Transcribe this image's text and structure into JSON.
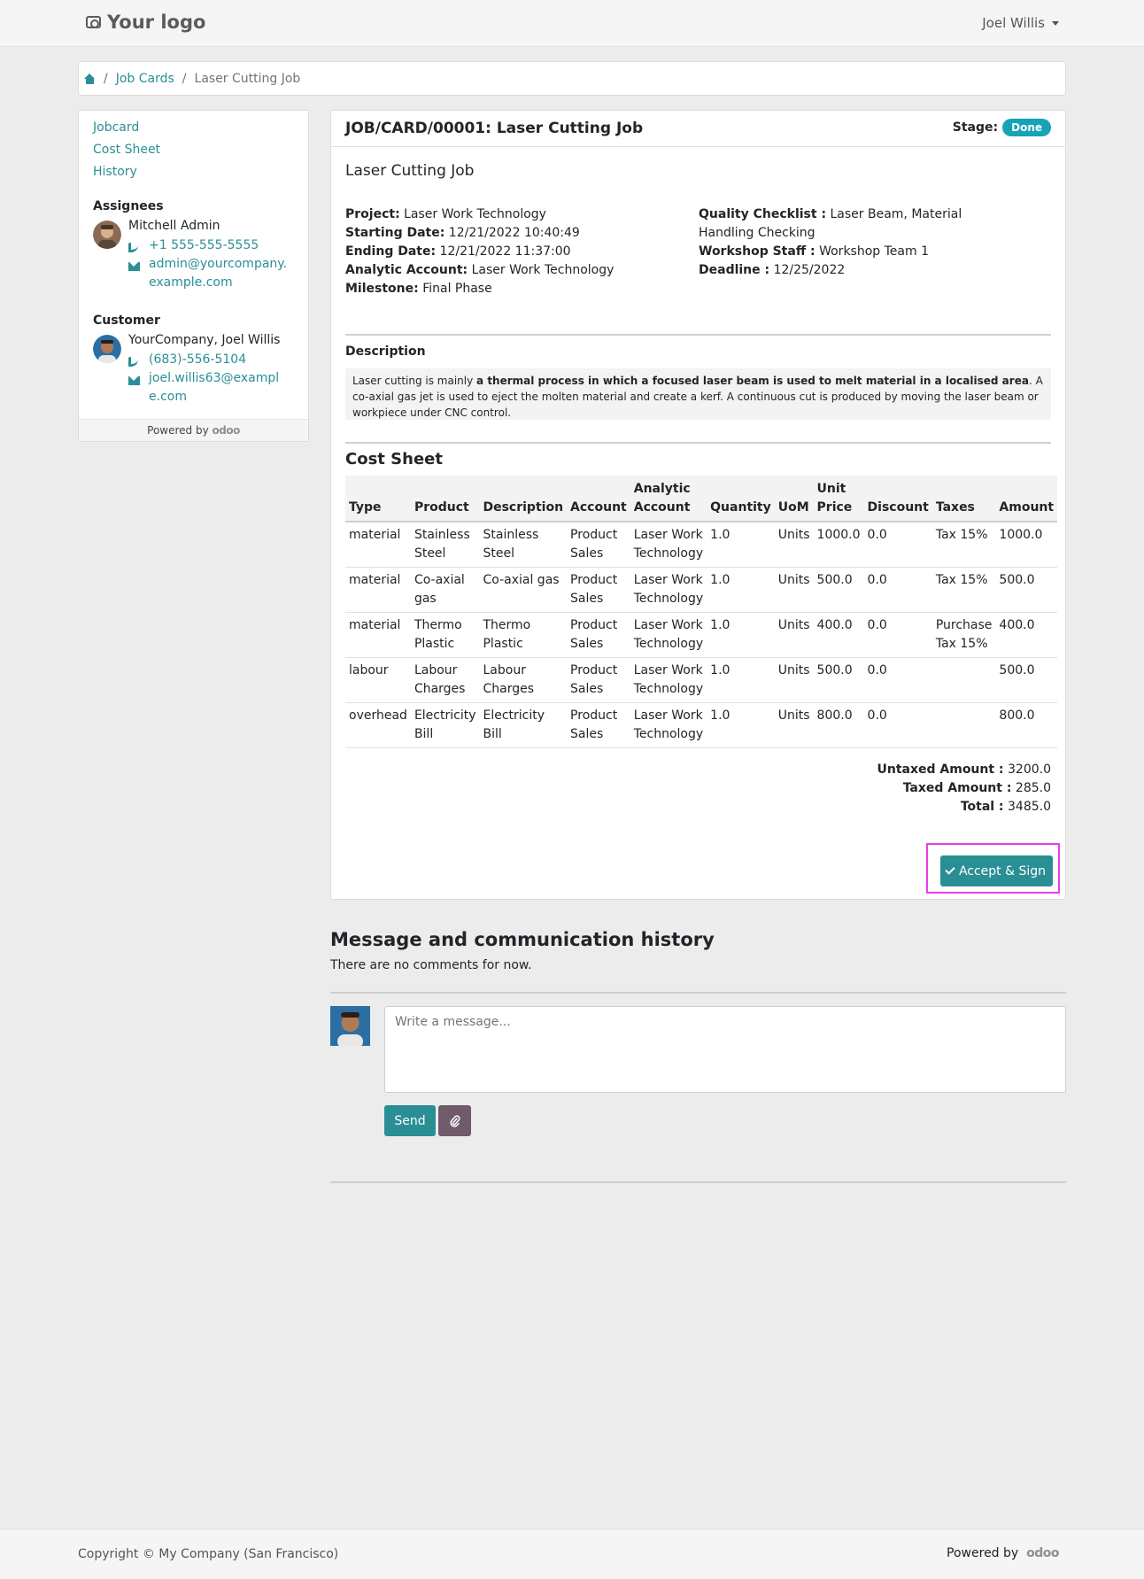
{
  "navbar": {
    "logo_text": "Your logo",
    "user_name": "Joel Willis"
  },
  "breadcrumb": {
    "home_icon": "home-icon",
    "job_cards": "Job Cards",
    "current": "Laser Cutting Job"
  },
  "sidebar": {
    "links": [
      "Jobcard",
      "Cost Sheet",
      "History"
    ],
    "assignees_heading": "Assignees",
    "assignee": {
      "name": "Mitchell Admin",
      "phone": "+1 555-555-5555",
      "email": "admin@yourcompany.example.com"
    },
    "customer_heading": "Customer",
    "customer": {
      "name": "YourCompany, Joel Willis",
      "phone": "(683)-556-5104",
      "email": "joel.willis63@example.com"
    },
    "powered_by": "Powered by",
    "brand": "odoo"
  },
  "card": {
    "title": "JOB/CARD/00001: Laser Cutting Job",
    "stage_label": "Stage:",
    "stage_value": "Done",
    "job_name": "Laser Cutting Job",
    "left_info": {
      "project_label": "Project:",
      "project": "Laser Work Technology",
      "start_label": "Starting Date:",
      "start": "12/21/2022 10:40:49",
      "end_label": "Ending Date:",
      "end": "12/21/2022 11:37:00",
      "analytic_label": "Analytic Account:",
      "analytic": "Laser Work Technology",
      "milestone_label": "Milestone:",
      "milestone": "Final Phase"
    },
    "right_info": {
      "checklist_label": "Quality Checklist :",
      "checklist": "Laser Beam, Material Handling Checking",
      "staff_label": "Workshop Staff :",
      "staff": "Workshop Team 1",
      "deadline_label": "Deadline :",
      "deadline": "12/25/2022"
    },
    "description_heading": "Description",
    "description": {
      "part1": "Laser cutting is mainly ",
      "bold": "a thermal process in which a focused laser beam is used to melt material in a localised area",
      "part2": ". A co-axial gas jet is used to eject the molten material and create a kerf. A continuous cut is produced by moving the laser beam or workpiece under CNC control."
    },
    "cost_sheet_title": "Cost Sheet",
    "table": {
      "headers": [
        "Type",
        "Product",
        "Description",
        "Account",
        "Analytic Account",
        "Quantity",
        "UoM",
        "Unit Price",
        "Discount",
        "Taxes",
        "Amount"
      ],
      "rows": [
        [
          "material",
          "Stainless Steel",
          "Stainless Steel",
          "Product Sales",
          "Laser Work Technology",
          "1.0",
          "Units",
          "1000.0",
          "0.0",
          "Tax 15%",
          "1000.0"
        ],
        [
          "material",
          "Co-axial gas",
          "Co-axial gas",
          "Product Sales",
          "Laser Work Technology",
          "1.0",
          "Units",
          "500.0",
          "0.0",
          "Tax 15%",
          "500.0"
        ],
        [
          "material",
          "Thermo Plastic",
          "Thermo Plastic",
          "Product Sales",
          "Laser Work Technology",
          "1.0",
          "Units",
          "400.0",
          "0.0",
          "Purchase Tax 15%",
          "400.0"
        ],
        [
          "labour",
          "Labour Charges",
          "Labour Charges",
          "Product Sales",
          "Laser Work Technology",
          "1.0",
          "Units",
          "500.0",
          "0.0",
          "",
          "500.0"
        ],
        [
          "overhead",
          "Electricity Bill",
          "Electricity Bill",
          "Product Sales",
          "Laser Work Technology",
          "1.0",
          "Units",
          "800.0",
          "0.0",
          "",
          "800.0"
        ]
      ]
    },
    "totals": {
      "untaxed_label": "Untaxed Amount :",
      "untaxed": "3200.0",
      "taxed_label": "Taxed Amount :",
      "taxed": "285.0",
      "total_label": "Total :",
      "total": "3485.0"
    },
    "sign_button": "Accept & Sign"
  },
  "messages": {
    "title": "Message and communication history",
    "empty": "There are no comments for now.",
    "placeholder": "Write a message...",
    "send": "Send",
    "attach_icon": "paperclip-icon"
  },
  "footer": {
    "copyright": "Copyright © My Company (San Francisco)",
    "powered_by": "Powered by",
    "brand": "odoo"
  },
  "colors": {
    "accent": "#2a8f94",
    "stage_badge": "#17a2b8",
    "attach_button": "#6f5b6c",
    "highlight_border": "#e83ee8"
  }
}
